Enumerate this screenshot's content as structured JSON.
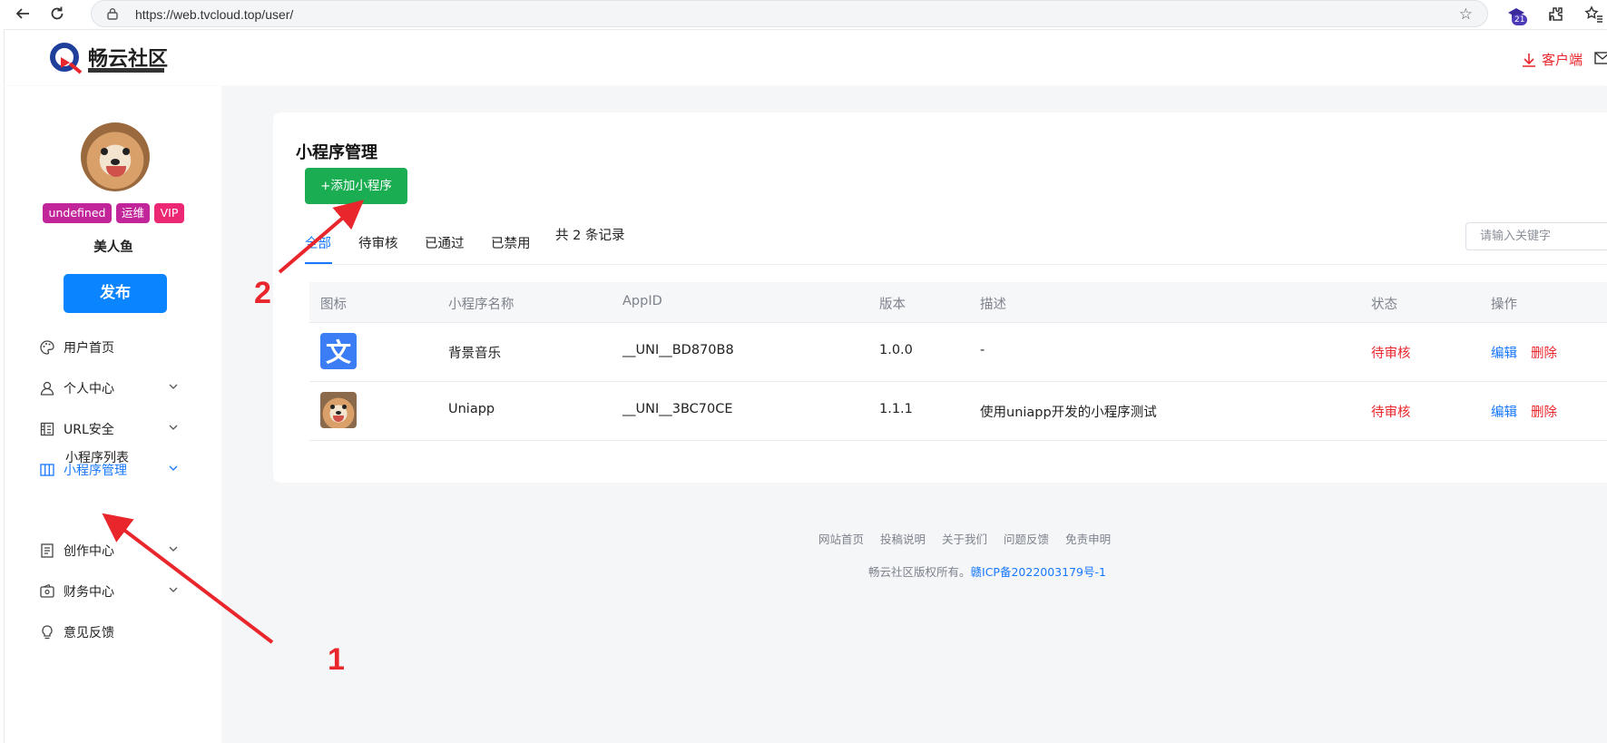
{
  "browser": {
    "url": "https://web.tvcloud.top/user/",
    "extension_badge": "21"
  },
  "header": {
    "logo_text": "畅云社区",
    "client_label": "客户端"
  },
  "sidebar": {
    "tags": [
      {
        "label": "undefined",
        "color": "#c2259a"
      },
      {
        "label": "运维",
        "color": "#c2259a"
      },
      {
        "label": "VIP",
        "color": "#ec2773"
      }
    ],
    "username": "美人鱼",
    "publish_label": "发布",
    "menu": [
      {
        "label": "用户首页",
        "icon": "palette-icon",
        "expandable": false,
        "active": false
      },
      {
        "label": "个人中心",
        "icon": "user-icon",
        "expandable": true,
        "active": false
      },
      {
        "label": "URL安全",
        "icon": "building-icon",
        "expandable": true,
        "active": false
      },
      {
        "label": "小程序管理",
        "icon": "columns-icon",
        "expandable": true,
        "active": true
      },
      {
        "label": "创作中心",
        "icon": "document-icon",
        "expandable": true,
        "active": false
      },
      {
        "label": "财务中心",
        "icon": "wallet-icon",
        "expandable": true,
        "active": false
      },
      {
        "label": "意见反馈",
        "icon": "bulb-icon",
        "expandable": false,
        "active": false
      }
    ],
    "submenu_label": "小程序列表"
  },
  "main": {
    "title": "小程序管理",
    "add_label": "+添加小程序",
    "tabs": [
      {
        "label": "全部",
        "active": true
      },
      {
        "label": "待审核",
        "active": false
      },
      {
        "label": "已通过",
        "active": false
      },
      {
        "label": "已禁用",
        "active": false
      }
    ],
    "record_count": "共 2 条记录",
    "search_placeholder": "请输入关键字",
    "columns": [
      "图标",
      "小程序名称",
      "AppID",
      "版本",
      "描述",
      "状态",
      "操作"
    ],
    "rows": [
      {
        "icon": "wen-app-icon",
        "name": "背景音乐",
        "appid": "__UNI__BD870B8",
        "version": "1.0.0",
        "desc": "-",
        "status": "待审核",
        "edit": "编辑",
        "delete": "删除"
      },
      {
        "icon": "dog-app-icon",
        "name": "Uniapp",
        "appid": "__UNI__3BC70CE",
        "version": "1.1.1",
        "desc": "使用uniapp开发的小程序测试",
        "status": "待审核",
        "edit": "编辑",
        "delete": "删除"
      }
    ]
  },
  "footer": {
    "links": [
      "网站首页",
      "投稿说明",
      "关于我们",
      "问题反馈",
      "免责申明"
    ],
    "copyright": "畅云社区版权所有。",
    "icp": "赣ICP备2022003179号-1"
  },
  "annotations": {
    "step1": "1",
    "step2": "2",
    "color": "#e8262c"
  }
}
